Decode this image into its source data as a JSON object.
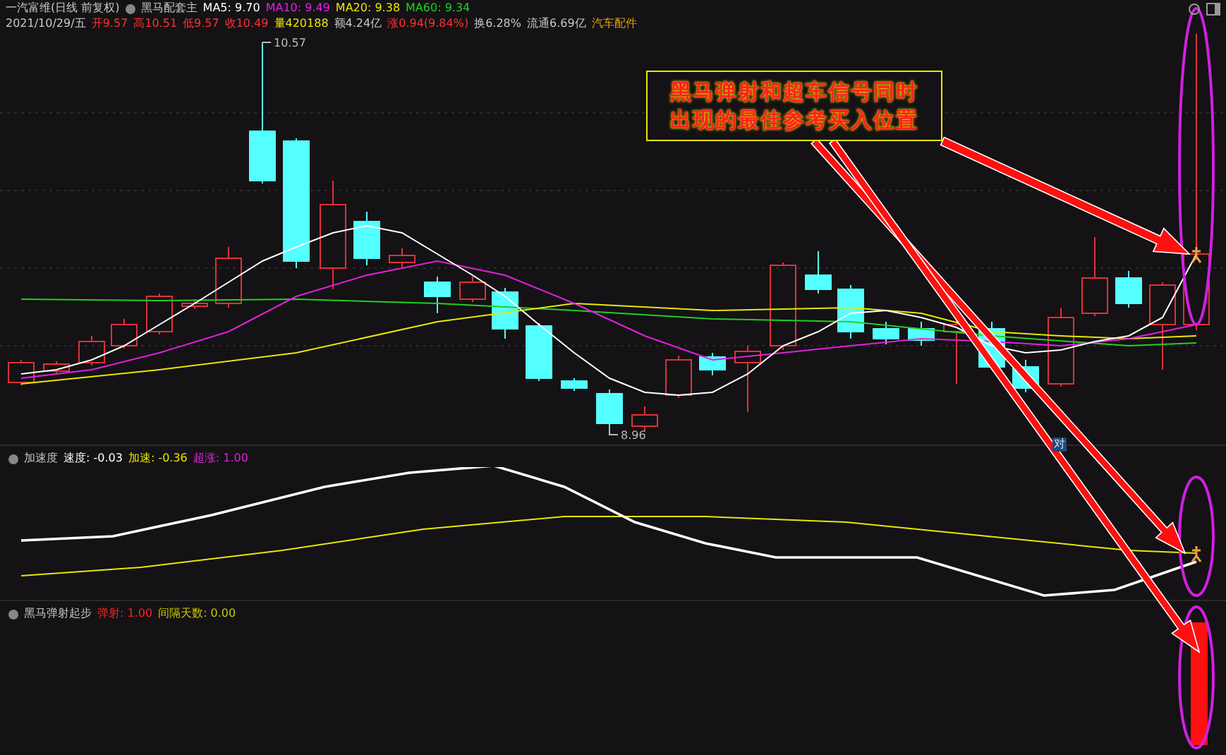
{
  "header": {
    "title": "一汽富维(日线 前复权)",
    "indicator": "黑马配套主",
    "ma": [
      {
        "label": "MA5: 9.70",
        "color": "#ffffff"
      },
      {
        "label": "MA10: 9.49",
        "color": "#e020e0"
      },
      {
        "label": "MA20: 9.38",
        "color": "#e8e800"
      },
      {
        "label": "MA60: 9.34",
        "color": "#20d020"
      }
    ]
  },
  "quote": [
    {
      "text": "2021/10/29/五",
      "color": "#c8c8c8"
    },
    {
      "text": "开9.57",
      "color": "#ff3030"
    },
    {
      "text": "高10.51",
      "color": "#ff3030"
    },
    {
      "text": "低9.57",
      "color": "#ff3030"
    },
    {
      "text": "收10.49",
      "color": "#ff3030"
    },
    {
      "text": "量420188",
      "color": "#e8e800"
    },
    {
      "text": "额4.24亿",
      "color": "#c8c8c8"
    },
    {
      "text": "涨0.94(9.84%)",
      "color": "#ff3030"
    },
    {
      "text": "换6.28%",
      "color": "#c8c8c8"
    },
    {
      "text": "流通6.69亿",
      "color": "#c8c8c8"
    },
    {
      "text": "汽车配件",
      "color": "#e8a000"
    }
  ],
  "price_labels": {
    "high": "10.57",
    "low": "8.96"
  },
  "badge": "对",
  "callout": {
    "lines": [
      "黑马弹射和超车信号同时",
      "出现的最佳参考买入位置"
    ]
  },
  "panels": [
    {
      "name": "加速度",
      "values": [
        {
          "label": "速度: -0.03",
          "color": "#ffffff"
        },
        {
          "label": "加速: -0.36",
          "color": "#e8e800"
        },
        {
          "label": "超涨: 1.00",
          "color": "#e020e0"
        }
      ]
    },
    {
      "name": "黑马弹射起步",
      "values": [
        {
          "label": "弹射: 1.00",
          "color": "#ff2020"
        },
        {
          "label": "间隔天数: 0.00",
          "color": "#c8c800"
        }
      ]
    }
  ]
}
